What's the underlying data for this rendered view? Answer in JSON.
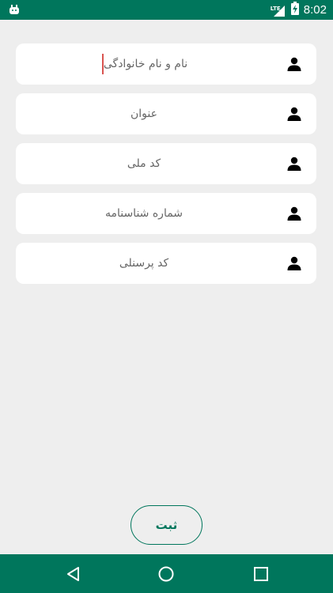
{
  "colors": {
    "primary": "#00765c",
    "background": "#eeeeee",
    "field_background": "#ffffff",
    "cursor": "#d9534f"
  },
  "status_bar": {
    "time": "8:02",
    "network": "LTE",
    "notification_icon": "android-icon",
    "signal_icon": "signal-icon",
    "battery_icon": "battery-charging-icon"
  },
  "form": {
    "fields": [
      {
        "placeholder": "نام و نام خانوادگی",
        "icon": "person-icon",
        "focused": true
      },
      {
        "placeholder": "عنوان",
        "icon": "person-icon",
        "focused": false
      },
      {
        "placeholder": "کد ملی",
        "icon": "person-icon",
        "focused": false
      },
      {
        "placeholder": "شماره شناسنامه",
        "icon": "person-icon",
        "focused": false
      },
      {
        "placeholder": "کد پرسنلی",
        "icon": "person-icon",
        "focused": false
      }
    ],
    "submit_label": "ثبت"
  },
  "nav_bar": {
    "back_icon": "back-triangle-icon",
    "home_icon": "home-circle-icon",
    "recents_icon": "recents-square-icon"
  }
}
